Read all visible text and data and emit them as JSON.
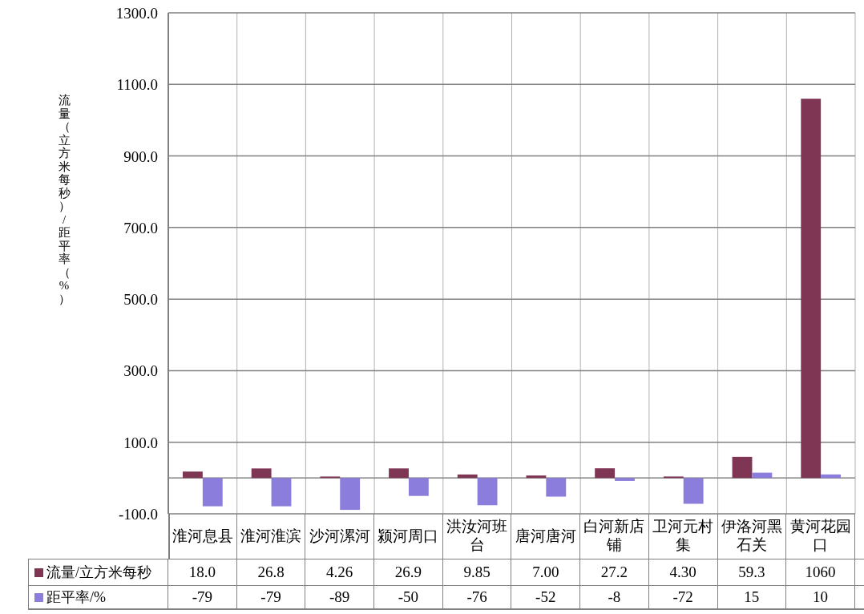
{
  "chart_data": {
    "type": "bar",
    "ylabel": "流量（立方米每秒）/距平率（%）",
    "categories": [
      "淮河息县",
      "淮河淮滨",
      "沙河漯河",
      "颍河周口",
      "洪汝河班台",
      "唐河唐河",
      "白河新店铺",
      "卫河元村集",
      "伊洛河黑石关",
      "黄河花园口"
    ],
    "series": [
      {
        "name": "流量/立方米每秒",
        "color": "#7f3654",
        "values": [
          18.0,
          26.8,
          4.26,
          26.9,
          9.85,
          7.0,
          27.2,
          4.3,
          59.3,
          1060
        ]
      },
      {
        "name": "距平率/%",
        "color": "#8a7ddb",
        "values": [
          -79,
          -79,
          -89,
          -50,
          -76,
          -52,
          -8,
          -72,
          15,
          10
        ]
      }
    ],
    "ylim": [
      -100,
      1300
    ],
    "grid": true,
    "legend": true,
    "yticks": [
      {
        "value": 1300,
        "label": "1300.0"
      },
      {
        "value": 1100,
        "label": "1100.0"
      },
      {
        "value": 900,
        "label": "900.0"
      },
      {
        "value": 700,
        "label": "700.0"
      },
      {
        "value": 500,
        "label": "500.0"
      },
      {
        "value": 300,
        "label": "300.0"
      },
      {
        "value": 100,
        "label": "100.0"
      },
      {
        "value": -100,
        "label": "-100.0"
      }
    ]
  },
  "data_table": {
    "rows": [
      {
        "cells": [
          "18.0",
          "26.8",
          "4.26",
          "26.9",
          "9.85",
          "7.00",
          "27.2",
          "4.30",
          "59.3",
          "1060"
        ]
      },
      {
        "cells": [
          "-79",
          "-79",
          "-89",
          "-50",
          "-76",
          "-52",
          "-8",
          "-72",
          "15",
          "10"
        ]
      }
    ]
  }
}
